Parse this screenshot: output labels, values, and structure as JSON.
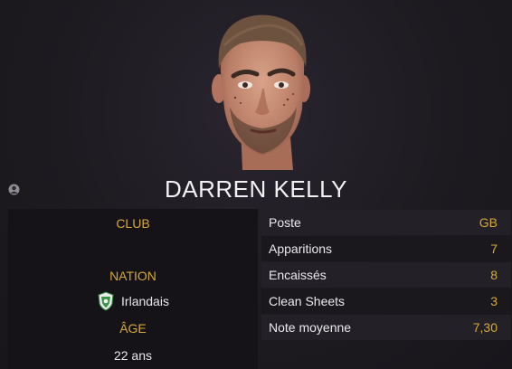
{
  "player": {
    "name": "DARREN KELLY"
  },
  "info": {
    "club_label": "CLUB",
    "club_value": "",
    "nation_label": "NATION",
    "nation_value": "Irlandais",
    "age_label": "ÂGE",
    "age_value": "22 ans"
  },
  "stats": [
    {
      "label": "Poste",
      "value": "GB"
    },
    {
      "label": "Apparitions",
      "value": "7"
    },
    {
      "label": "Encaissés",
      "value": "8"
    },
    {
      "label": "Clean Sheets",
      "value": "3"
    },
    {
      "label": "Note moyenne",
      "value": "7,30"
    }
  ],
  "icons": {
    "profile": "person-icon",
    "nation_crest": "fai-crest-icon"
  },
  "colors": {
    "accent": "#d4a93a",
    "background": "#1d1a20",
    "panel": "#151317",
    "row_light": "#232027",
    "row_dark": "#1a181c"
  }
}
